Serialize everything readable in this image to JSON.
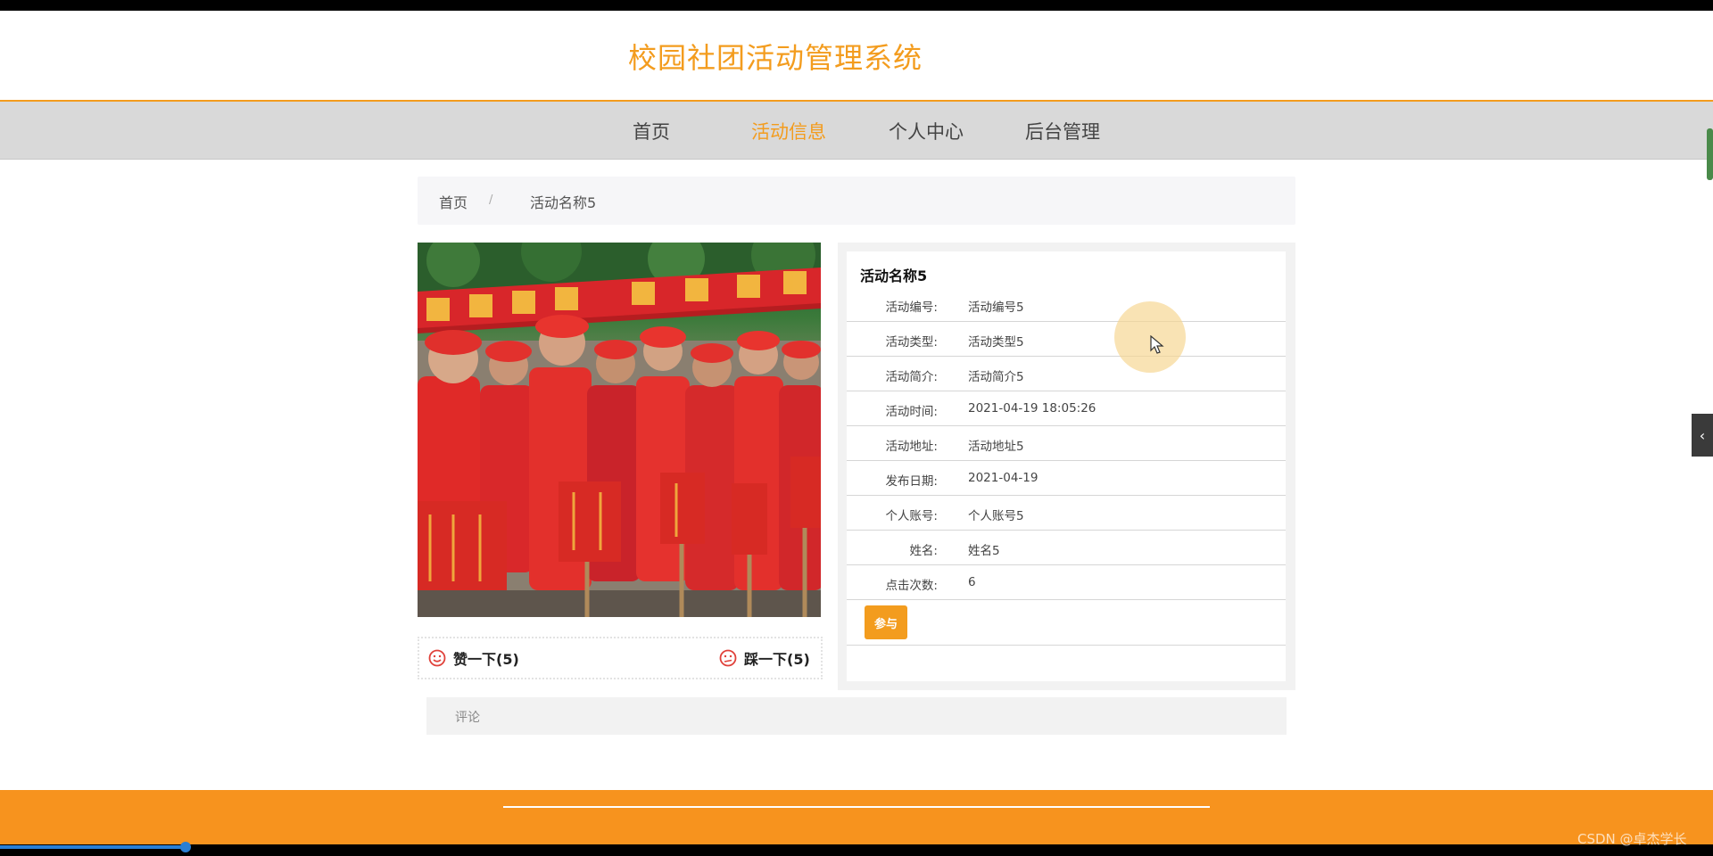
{
  "site": {
    "title": "校园社团活动管理系统"
  },
  "nav": {
    "items": [
      {
        "label": "首页"
      },
      {
        "label": "活动信息"
      },
      {
        "label": "个人中心"
      },
      {
        "label": "后台管理"
      }
    ],
    "active": "活动信息"
  },
  "breadcrumb": {
    "home": "首页",
    "separator": "/",
    "current": "活动名称5"
  },
  "votes": {
    "like_label": "赞一下(5)",
    "dislike_label": "踩一下(5)"
  },
  "detail": {
    "title": "活动名称5",
    "fields": [
      {
        "label": "活动编号:",
        "value": "活动编号5"
      },
      {
        "label": "活动类型:",
        "value": "活动类型5"
      },
      {
        "label": "活动简介:",
        "value": "活动简介5"
      },
      {
        "label": "活动时间:",
        "value": "2021-04-19 18:05:26"
      },
      {
        "label": "活动地址:",
        "value": "活动地址5"
      },
      {
        "label": "发布日期:",
        "value": "2021-04-19"
      },
      {
        "label": "个人账号:",
        "value": "个人账号5"
      },
      {
        "label": "姓名:",
        "value": "姓名5"
      },
      {
        "label": "点击次数:",
        "value": "6"
      }
    ],
    "join_label": "参与"
  },
  "comments": {
    "label": "评论"
  },
  "side_tab": {
    "glyph": "‹"
  },
  "watermark": "CSDN @卓杰学长",
  "colors": {
    "accent": "#f39c1e",
    "footer": "#f7931e",
    "nav_bg": "#d9d9d9"
  },
  "icons": {
    "like": "smile-face-icon",
    "dislike": "frown-face-icon",
    "side_tab": "chevron-left-icon",
    "cursor": "mouse-pointer-icon"
  }
}
